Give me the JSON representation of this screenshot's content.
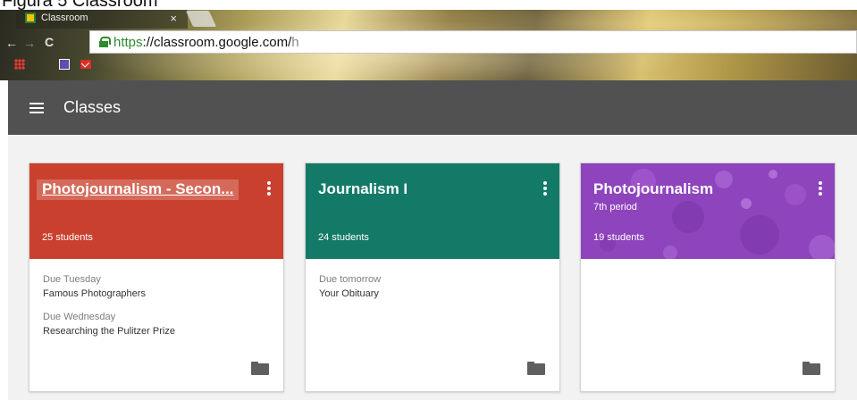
{
  "caption": "Figura 5 Classroom",
  "browser": {
    "tab_title": "Classroom",
    "tab_close": "×",
    "url_secure": "https",
    "url_host": "://classroom.google.com/",
    "url_path": "h",
    "back_glyph": "←",
    "forward_glyph": "→",
    "reload_glyph": "C"
  },
  "appbar": {
    "title": "Classes",
    "menu_icon": "hamburger-menu-icon"
  },
  "colors": {
    "appbar": "#515151",
    "card_red": "#c9402e",
    "card_teal": "#147a68",
    "card_purple": "#8e44bd",
    "background": "#f2f2f2"
  },
  "cards": [
    {
      "title": "Photojournalism - Secon...",
      "subtitle": "",
      "students": "25 students",
      "color": "#c9402e",
      "due": [
        {
          "label": "Due Tuesday",
          "item": "Famous Photographers"
        },
        {
          "label": "Due Wednesday",
          "item": "Researching the Pulitzer Prize"
        }
      ]
    },
    {
      "title": "Journalism I",
      "subtitle": "",
      "students": "24 students",
      "color": "#147a68",
      "due": [
        {
          "label": "Due tomorrow",
          "item": "Your Obituary"
        }
      ]
    },
    {
      "title": "Photojournalism",
      "subtitle": "7th period",
      "students": "19 students",
      "color": "#8e44bd",
      "due": []
    }
  ]
}
